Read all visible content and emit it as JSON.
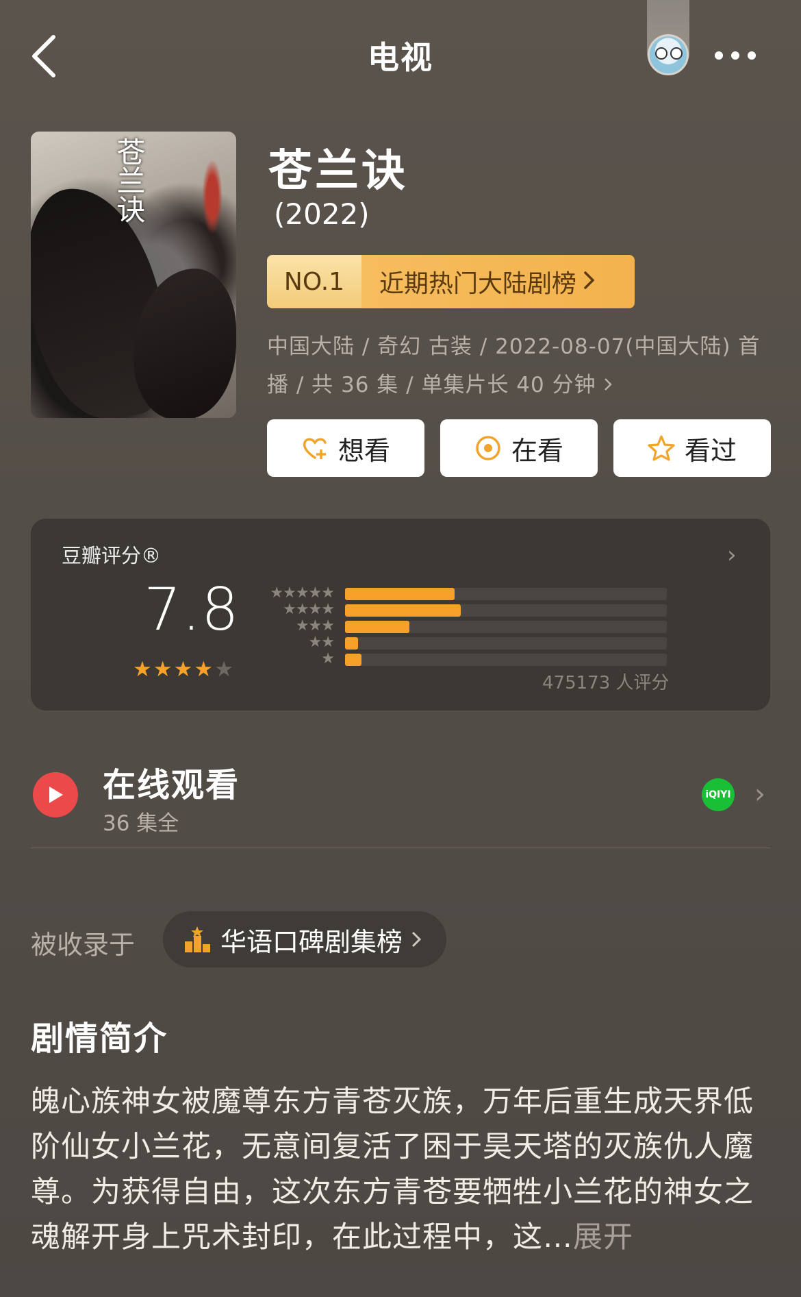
{
  "nav": {
    "title": "电视"
  },
  "show": {
    "title": "苍兰诀",
    "year": "(2022)",
    "rank_no": "NO.1",
    "rank_label": "近期热门大陆剧榜",
    "meta_line1": "中国大陆 / 奇幻 古装 / 2022-08-07(中国大陆) 首",
    "meta_line2": "播 / 共 36 集 / 单集片长 40 分钟"
  },
  "actions": {
    "want": "想看",
    "watching": "在看",
    "watched": "看过"
  },
  "rating": {
    "label": "豆瓣评分®",
    "score": "7.8",
    "stars": 4,
    "star_max": 5,
    "count_text": "475173 人评分",
    "distribution": [
      {
        "stars": 5,
        "fraction": 0.34
      },
      {
        "stars": 4,
        "fraction": 0.36
      },
      {
        "stars": 3,
        "fraction": 0.2
      },
      {
        "stars": 2,
        "fraction": 0.04
      },
      {
        "stars": 1,
        "fraction": 0.05
      }
    ],
    "accent_color": "#f7a02a"
  },
  "online": {
    "title": "在线观看",
    "subtitle": "36 集全",
    "platform_icon": "iqiyi-icon"
  },
  "collected": {
    "label": "被收录于",
    "chip": "华语口碑剧集榜"
  },
  "synopsis": {
    "title": "剧情简介",
    "text": "魄心族神女被魔尊东方青苍灭族，万年后重生成天界低阶仙女小兰花，无意间复活了困于昊天塔的灭族仇人魔尊。为获得自由，这次东方青苍要牺牲小兰花的神女之魂解开身上咒术封印，在此过程中，这…",
    "expand": "展开"
  },
  "poster": {
    "calligraphy": "苍兰诀"
  }
}
